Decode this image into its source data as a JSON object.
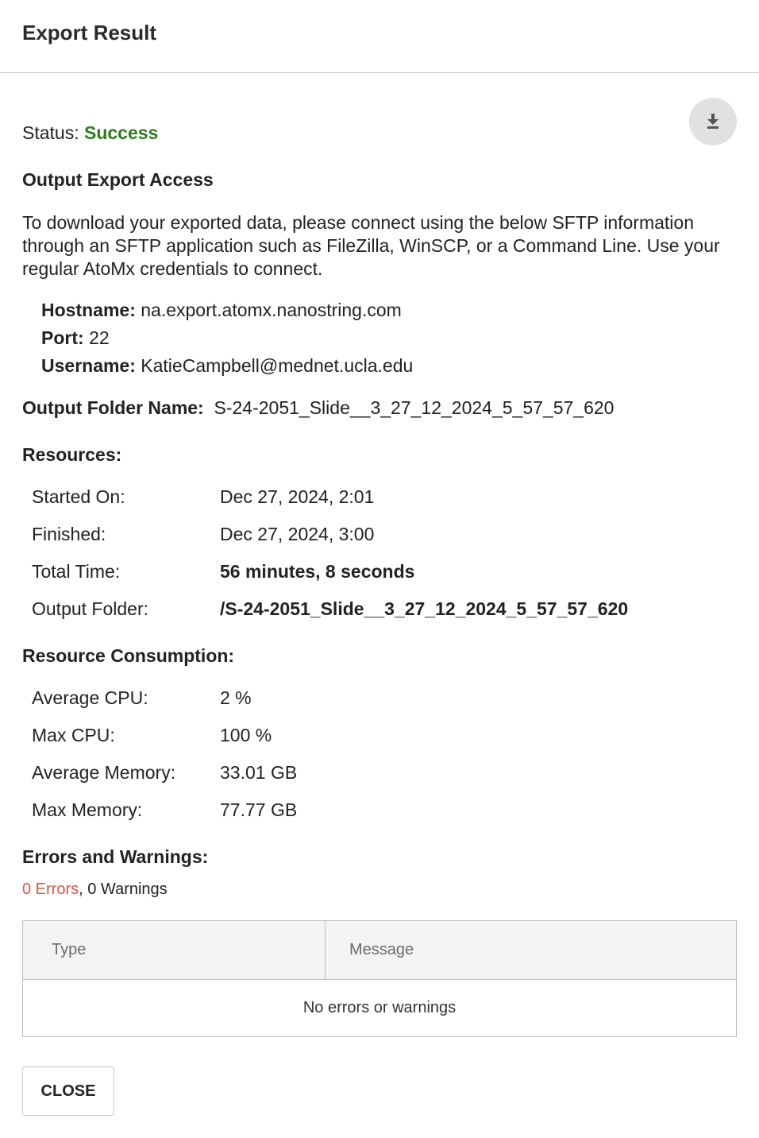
{
  "dialog": {
    "title": "Export Result",
    "download_icon": "download-icon"
  },
  "status": {
    "label": "Status:",
    "value": "Success",
    "color": "#2f7d1c"
  },
  "access": {
    "heading": "Output Export Access",
    "description": "To download your exported data, please connect using the below SFTP information through an SFTP application such as FileZilla, WinSCP, or a Command Line. Use your regular AtoMx credentials to connect.",
    "hostname_label": "Hostname:",
    "hostname_value": "na.export.atomx.nanostring.com",
    "port_label": "Port:",
    "port_value": "22",
    "username_label": "Username:",
    "username_value": "KatieCampbell@mednet.ucla.edu"
  },
  "output_folder": {
    "label": "Output Folder Name:",
    "value": "S-24-2051_Slide__3_27_12_2024_5_57_57_620"
  },
  "resources": {
    "heading": "Resources:",
    "rows": [
      {
        "label": "Started On:",
        "value": "Dec 27, 2024, 2:01"
      },
      {
        "label": "Finished:",
        "value": "Dec 27, 2024, 3:00"
      },
      {
        "label": "Total Time:",
        "value": "56 minutes, 8 seconds"
      },
      {
        "label": "Output Folder:",
        "value": "/S-24-2051_Slide__3_27_12_2024_5_57_57_620"
      }
    ]
  },
  "consumption": {
    "heading": "Resource Consumption:",
    "rows": [
      {
        "label": "Average CPU:",
        "value": "2 %"
      },
      {
        "label": "Max CPU:",
        "value": "100 %"
      },
      {
        "label": "Average Memory:",
        "value": "33.01 GB"
      },
      {
        "label": "Max Memory:",
        "value": "77.77 GB"
      }
    ]
  },
  "errors": {
    "heading": "Errors and Warnings:",
    "errors_count": "0 Errors",
    "separator": ", ",
    "warnings_count": "0 Warnings",
    "error_color": "#e05343",
    "table": {
      "columns": [
        "Type",
        "Message"
      ],
      "empty_message": "No errors or warnings"
    }
  },
  "footer": {
    "close_label": "CLOSE"
  }
}
